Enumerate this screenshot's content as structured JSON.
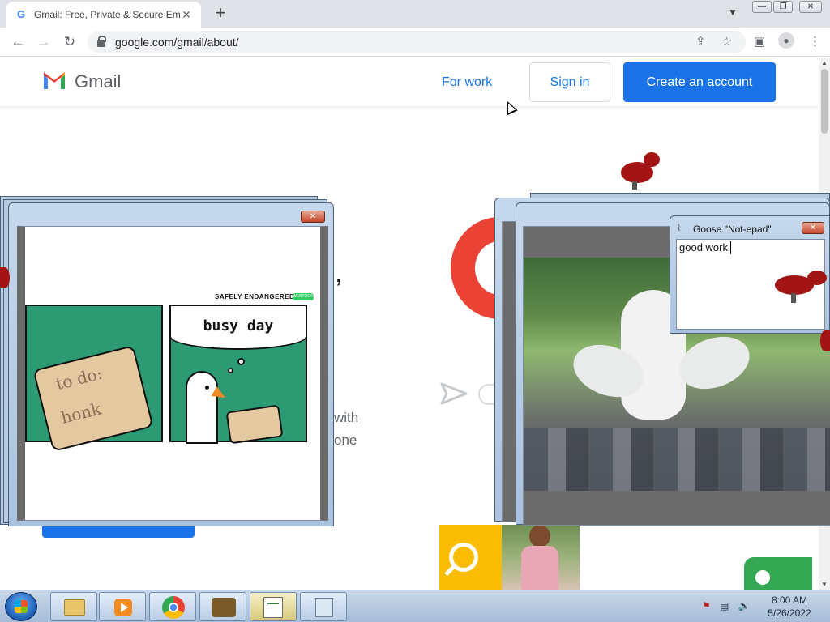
{
  "browser": {
    "tab_title": "Gmail: Free, Private & Secure Em",
    "tab_favicon": "G",
    "url": "google.com/gmail/about/"
  },
  "gmail_header": {
    "brand": "Gmail",
    "for_work": "For work",
    "sign_in": "Sign in",
    "create_account": "Create an account",
    "colors": {
      "link": "#1a73e8",
      "primary": "#1a73e8"
    }
  },
  "background_text": {
    "comma": ",",
    "line1": "with",
    "line2": "one"
  },
  "comic": {
    "header_label": "SAFELY ENDANGERED",
    "badge": "WEBTOON",
    "bubble": "busy day",
    "scroll_line1": "to do:",
    "scroll_line2": "honk"
  },
  "notepad": {
    "title": "Goose \"Not-epad\"",
    "text": "good work"
  },
  "taskbar": {
    "time": "8:00 AM",
    "date": "5/26/2022"
  }
}
